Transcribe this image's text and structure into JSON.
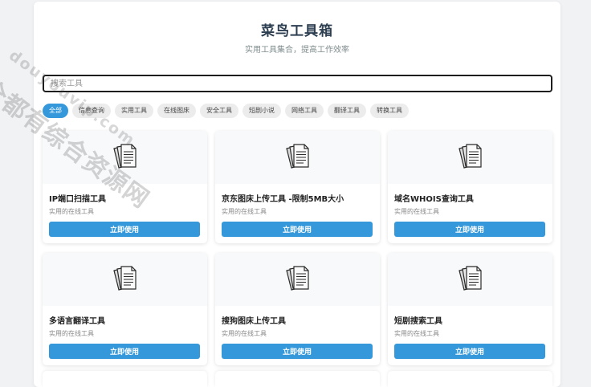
{
  "header": {
    "title": "菜鸟工具箱",
    "subtitle": "实用工具集合，提高工作效率"
  },
  "search": {
    "placeholder": "搜索工具",
    "value": ""
  },
  "categories": [
    {
      "label": "全部",
      "active": true
    },
    {
      "label": "信息查询",
      "active": false
    },
    {
      "label": "实用工具",
      "active": false
    },
    {
      "label": "在线图床",
      "active": false
    },
    {
      "label": "安全工具",
      "active": false
    },
    {
      "label": "短剧小说",
      "active": false
    },
    {
      "label": "网络工具",
      "active": false
    },
    {
      "label": "翻译工具",
      "active": false
    },
    {
      "label": "转换工具",
      "active": false
    }
  ],
  "tools": [
    {
      "title": "IP端口扫描工具",
      "desc": "实用的在线工具",
      "button": "立即使用",
      "icon": "document-icon"
    },
    {
      "title": "京东图床上传工具 -限制5MB大小",
      "desc": "实用的在线工具",
      "button": "立即使用",
      "icon": "document-icon"
    },
    {
      "title": "域名WHOIS查询工具",
      "desc": "实用的在线工具",
      "button": "立即使用",
      "icon": "document-icon"
    },
    {
      "title": "多语言翻译工具",
      "desc": "实用的在线工具",
      "button": "立即使用",
      "icon": "document-icon"
    },
    {
      "title": "搜狗图床上传工具",
      "desc": "实用的在线工具",
      "button": "立即使用",
      "icon": "document-icon"
    },
    {
      "title": "短剧搜索工具",
      "desc": "实用的在线工具",
      "button": "立即使用",
      "icon": "document-icon"
    }
  ],
  "watermark": {
    "line1": "全都有综合资源网",
    "line2": "douyouvip.com"
  },
  "colors": {
    "accent": "#3498db",
    "title": "#2c3e50",
    "background": "#f1f2f4"
  }
}
